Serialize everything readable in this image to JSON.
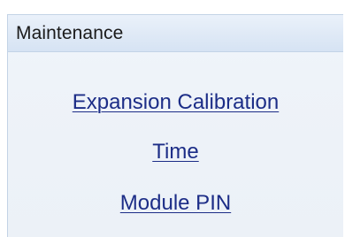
{
  "panel": {
    "title": "Maintenance",
    "links": [
      {
        "label": "Expansion Calibration"
      },
      {
        "label": "Time"
      },
      {
        "label": "Module PIN"
      }
    ]
  },
  "colors": {
    "link": "#1c2d87",
    "header_bg": "#d6e3f3",
    "panel_bg": "#eef3f9",
    "border": "#c3d3e6"
  }
}
